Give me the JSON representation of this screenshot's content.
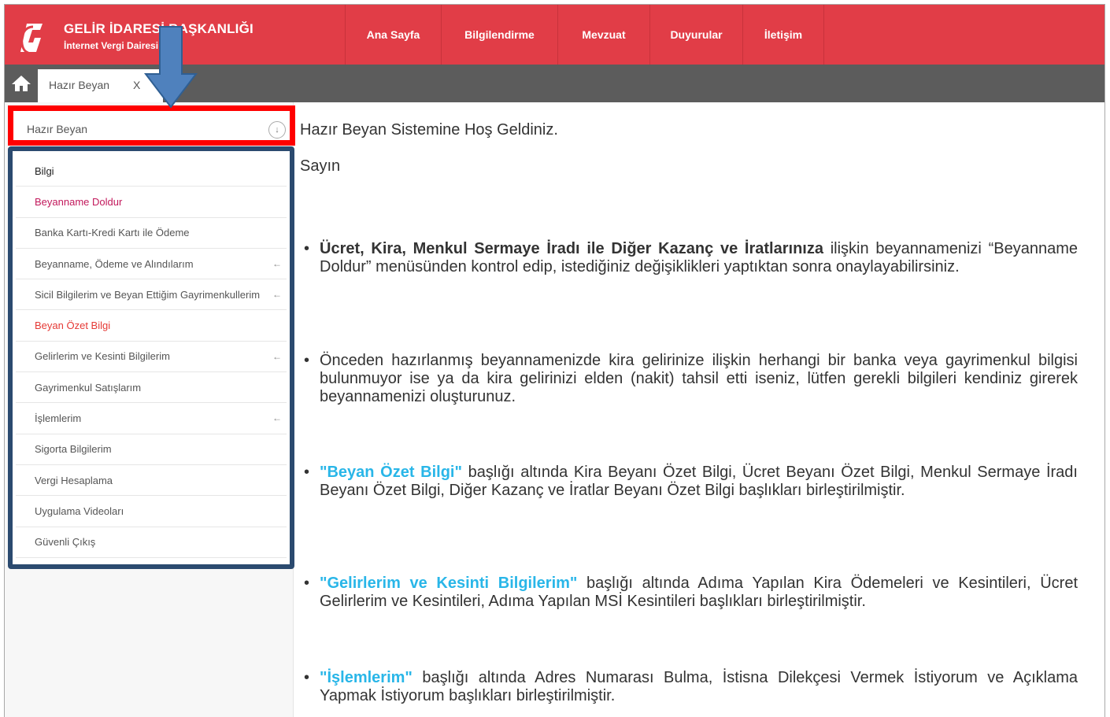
{
  "header": {
    "brand_title": "GELİR İDARESİ BAŞKANLIĞI",
    "brand_subtitle": "İnternet Vergi Dairesi",
    "nav": [
      "Ana Sayfa",
      "Bilgilendirme",
      "Mevzuat",
      "Duyurular",
      "İletişim"
    ],
    "color": "#e13d47"
  },
  "tabbar": {
    "tab_label": "Hazır Beyan",
    "tab_close": "X"
  },
  "sidebar": {
    "header_label": "Hazır Beyan",
    "header_icon": "↓",
    "items": [
      {
        "label": "Bilgi",
        "color": "#222222",
        "arrow": ""
      },
      {
        "label": "Beyanname Doldur",
        "color": "#c2185b",
        "arrow": ""
      },
      {
        "label": "Banka Kartı-Kredi Kartı ile Ödeme",
        "color": "#555555",
        "arrow": ""
      },
      {
        "label": "Beyanname, Ödeme ve Alındılarım",
        "color": "#555555",
        "arrow": "←"
      },
      {
        "label": "Sicil Bilgilerim ve Beyan Ettiğim Gayrimenkullerim",
        "color": "#555555",
        "arrow": "←"
      },
      {
        "label": "Beyan Özet Bilgi",
        "color": "#e53935",
        "arrow": ""
      },
      {
        "label": "Gelirlerim ve Kesinti Bilgilerim",
        "color": "#555555",
        "arrow": "←"
      },
      {
        "label": "Gayrimenkul Satışlarım",
        "color": "#555555",
        "arrow": ""
      },
      {
        "label": "İşlemlerim",
        "color": "#555555",
        "arrow": "←"
      },
      {
        "label": "Sigorta Bilgilerim",
        "color": "#555555",
        "arrow": ""
      },
      {
        "label": "Vergi Hesaplama",
        "color": "#555555",
        "arrow": ""
      },
      {
        "label": "Uygulama Videoları",
        "color": "#555555",
        "arrow": ""
      },
      {
        "label": "Güvenli Çıkış",
        "color": "#555555",
        "arrow": ""
      }
    ]
  },
  "main": {
    "welcome": "Hazır Beyan Sistemine Hoş Geldiniz.",
    "greeting": "Sayın",
    "bullets": [
      {
        "lead": "Ücret, Kira, Menkul Sermaye İradı ile Diğer Kazanç ve İratlarınıza",
        "lead_style": "bold",
        "rest": " ilişkin beyannamenizi “Beyanname Doldur” menüsünden kontrol edip, istediğiniz değişiklikleri yaptıktan sonra onaylayabilirsiniz."
      },
      {
        "lead": "",
        "lead_style": "none",
        "rest": "Önceden hazırlanmış beyannamenizde kira gelirinize ilişkin herhangi bir banka veya gayrimenkul bilgisi bulunmuyor ise ya da kira gelirinizi elden (nakit) tahsil etti iseniz, lütfen gerekli bilgileri kendiniz girerek beyannamenizi oluşturunuz."
      },
      {
        "lead": "\"Beyan Özet Bilgi\"",
        "lead_style": "link",
        "rest": " başlığı altında Kira Beyanı Özet Bilgi, Ücret Beyanı Özet Bilgi, Menkul Sermaye İradı Beyanı Özet Bilgi, Diğer Kazanç ve İratlar Beyanı Özet Bilgi başlıkları birleştirilmiştir."
      },
      {
        "lead": "\"Gelirlerim ve Kesinti Bilgilerim\"",
        "lead_style": "link",
        "rest": " başlığı altında Adıma Yapılan Kira Ödemeleri ve Kesintileri, Ücret Gelirlerim ve Kesintileri, Adıma Yapılan MSİ Kesintileri başlıkları birleştirilmiştir."
      },
      {
        "lead": "\"İşlemlerim\"",
        "lead_style": "link",
        "rest": " başlığı altında Adres Numarası Bulma, İstisna Dilekçesi Vermek İstiyorum ve Açıklama Yapmak İstiyorum başlıkları birleştirilmiştir."
      }
    ],
    "link_color": "#29b6e8"
  },
  "annotations": {
    "highlight_red": "#ff0000",
    "highlight_navy": "#2b4a6f",
    "arrow_color": "#4f81bd"
  }
}
